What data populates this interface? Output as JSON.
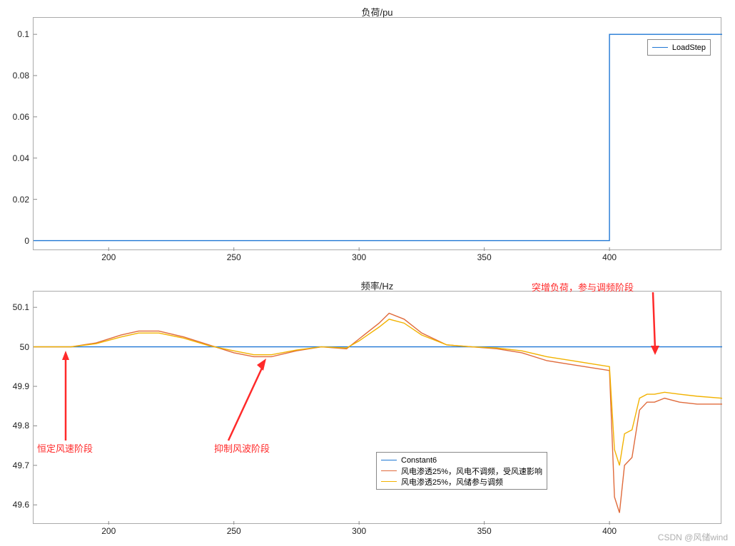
{
  "watermark": "CSDN @风储wind",
  "chart_data": [
    {
      "type": "line",
      "title": "负荷/pu",
      "xlabel": "",
      "ylabel": "",
      "xlim": [
        170,
        445
      ],
      "ylim": [
        -0.005,
        0.108
      ],
      "xticks": [
        200,
        250,
        300,
        350,
        400
      ],
      "yticks": [
        0,
        0.02,
        0.04,
        0.06,
        0.08,
        0.1
      ],
      "legend": [
        "LoadStep"
      ],
      "series": [
        {
          "name": "LoadStep",
          "color": "#1f77d4",
          "x": [
            170,
            400,
            400,
            445
          ],
          "y": [
            0,
            0,
            0.1,
            0.1
          ]
        }
      ]
    },
    {
      "type": "line",
      "title": "频率/Hz",
      "xlabel": "",
      "ylabel": "",
      "xlim": [
        170,
        445
      ],
      "ylim": [
        49.55,
        50.14
      ],
      "xticks": [
        200,
        250,
        300,
        350,
        400
      ],
      "yticks": [
        49.6,
        49.7,
        49.8,
        49.9,
        50,
        50.1
      ],
      "legend": [
        "Constant6",
        "风电渗透25%，风电不调频，受风速影响",
        "风电渗透25%，风储参与调频"
      ],
      "series": [
        {
          "name": "Constant6",
          "color": "#1f77d4",
          "x": [
            170,
            445
          ],
          "y": [
            50.0,
            50.0
          ]
        },
        {
          "name": "风电渗透25%，风电不调频，受风速影响",
          "color": "#e06b3c",
          "x": [
            170,
            185,
            195,
            205,
            212,
            220,
            230,
            240,
            250,
            258,
            265,
            275,
            285,
            295,
            300,
            308,
            312,
            318,
            325,
            335,
            345,
            355,
            365,
            375,
            385,
            395,
            400,
            402,
            404,
            406,
            409,
            412,
            415,
            418,
            422,
            428,
            435,
            445
          ],
          "y": [
            50.0,
            50.0,
            50.01,
            50.03,
            50.04,
            50.04,
            50.025,
            50.005,
            49.985,
            49.975,
            49.975,
            49.99,
            50.0,
            49.995,
            50.02,
            50.06,
            50.085,
            50.07,
            50.035,
            50.005,
            50.0,
            49.995,
            49.985,
            49.965,
            49.955,
            49.945,
            49.94,
            49.62,
            49.58,
            49.7,
            49.72,
            49.84,
            49.86,
            49.86,
            49.87,
            49.86,
            49.855,
            49.855
          ]
        },
        {
          "name": "风电渗透25%，风储参与调频",
          "color": "#f2b200",
          "x": [
            170,
            185,
            195,
            205,
            212,
            220,
            230,
            240,
            250,
            258,
            265,
            275,
            285,
            295,
            300,
            308,
            312,
            318,
            325,
            335,
            345,
            355,
            365,
            375,
            385,
            395,
            400,
            402,
            404,
            406,
            409,
            412,
            415,
            418,
            422,
            428,
            435,
            445
          ],
          "y": [
            50.0,
            50.0,
            50.008,
            50.025,
            50.035,
            50.035,
            50.022,
            50.003,
            49.99,
            49.98,
            49.98,
            49.992,
            50.0,
            49.997,
            50.015,
            50.05,
            50.07,
            50.06,
            50.03,
            50.005,
            50.0,
            49.997,
            49.99,
            49.975,
            49.965,
            49.955,
            49.95,
            49.74,
            49.7,
            49.78,
            49.79,
            49.87,
            49.88,
            49.88,
            49.885,
            49.88,
            49.875,
            49.87
          ]
        }
      ],
      "annotations": [
        {
          "text": "恒定风速阶段"
        },
        {
          "text": "抑制风波阶段"
        },
        {
          "text": "突增负荷，参与调频阶段"
        }
      ]
    }
  ]
}
